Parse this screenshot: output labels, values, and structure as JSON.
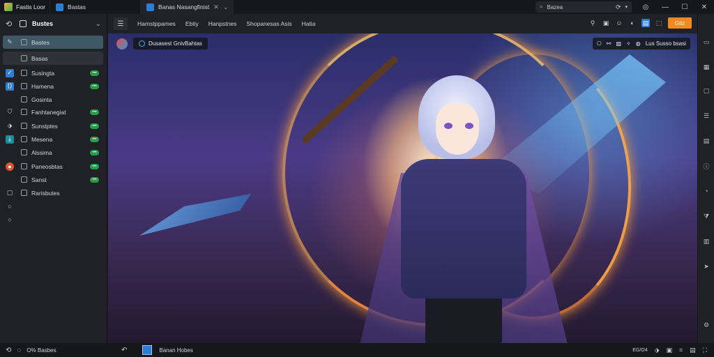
{
  "titlebar": {
    "app_name": "Fastis Loor",
    "tabs": [
      {
        "label": "Bastas",
        "icon": "app-icon"
      },
      {
        "label": "Banas Nasangfinist",
        "icon": "image-icon"
      }
    ],
    "search_label": "Bazea"
  },
  "sidebar": {
    "title": "Bustes",
    "items": [
      {
        "label": "Bastes"
      },
      {
        "label": "Basas"
      },
      {
        "label": "Susingta"
      },
      {
        "label": "Hamena"
      },
      {
        "label": "Gosinta"
      },
      {
        "label": "Fanhtanegiat"
      },
      {
        "label": "Sunstptes"
      },
      {
        "label": "Mesena"
      },
      {
        "label": "Alssima"
      },
      {
        "label": "Paneosbtas"
      },
      {
        "label": "Sanst"
      },
      {
        "label": "Rarisbutes"
      }
    ]
  },
  "toolbar": {
    "menus": [
      "Hamstppames",
      "Ebtiy",
      "Hanpstnes",
      "Shopanesas Asis",
      "Hatia"
    ],
    "action_label": "Gtiz"
  },
  "canvas": {
    "chip_label": "Dusasest GnivBahtas",
    "tools_label": "Lus Susso bsasi"
  },
  "statusbar": {
    "left_label": "O% Basbes",
    "mid_label": "Banan Hobes",
    "right_label": "EG/O4"
  },
  "colors": {
    "accent": "#2f7dd1",
    "action": "#f08a1c",
    "badge": "#2b9a4a",
    "selected": "#3f5866"
  }
}
